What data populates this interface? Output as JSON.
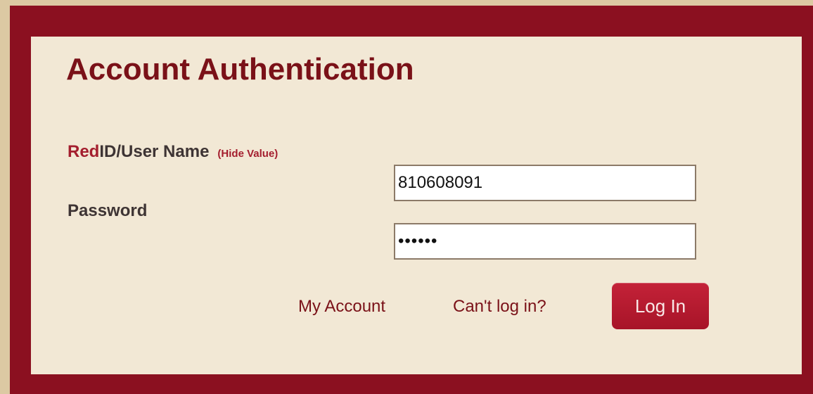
{
  "header": {
    "title": "Account Authentication"
  },
  "form": {
    "username_label_red": "Red",
    "username_label_rest": "ID/User Name",
    "hide_value_link": "(Hide Value)",
    "username_value": "810608091",
    "password_label": "Password",
    "password_value": "••••••"
  },
  "actions": {
    "my_account_link": "My Account",
    "cant_login_link": "Can't log in?",
    "login_button": "Log In"
  },
  "colors": {
    "frame": "#8b1020",
    "panel": "#f2e8d5",
    "page_background": "#dcc9a3",
    "accent": "#a41e2e"
  }
}
